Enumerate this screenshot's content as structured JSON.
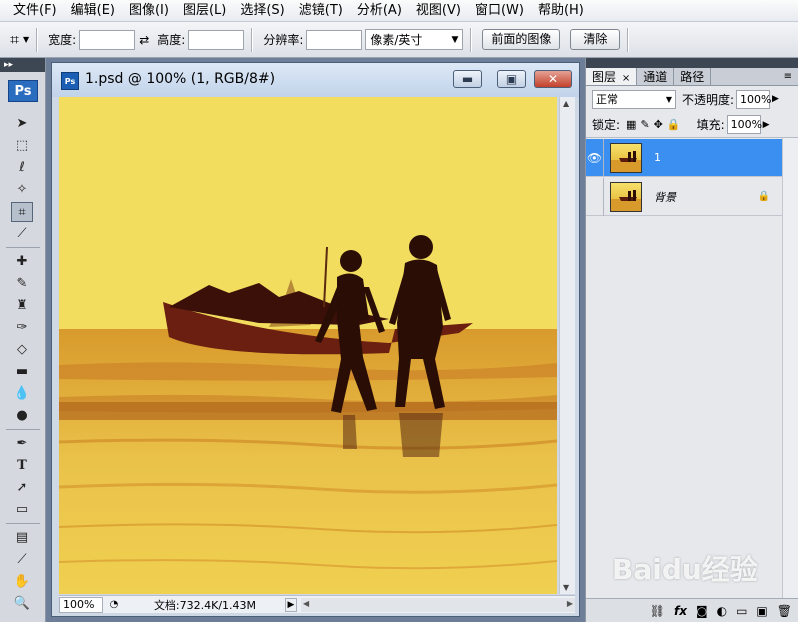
{
  "menu": [
    "文件(F)",
    "编辑(E)",
    "图像(I)",
    "图层(L)",
    "选择(S)",
    "滤镜(T)",
    "分析(A)",
    "视图(V)",
    "窗口(W)",
    "帮助(H)"
  ],
  "options": {
    "tool_icon": "crop-icon",
    "width_label": "宽度:",
    "height_label": "高度:",
    "resolution_label": "分辨率:",
    "unit_value": "像素/英寸",
    "front_image_button": "前面的图像",
    "clear_button": "清除"
  },
  "toolbox": {
    "logo": "Ps",
    "active_tool": "crop-icon"
  },
  "document": {
    "title": "1.psd @ 100% (1, RGB/8#)",
    "zoom": "100%",
    "doc_info": "文档:732.4K/1.43M"
  },
  "layers_panel": {
    "tabs": [
      "图层",
      "通道",
      "路径"
    ],
    "blend_mode": "正常",
    "opacity_label": "不透明度:",
    "opacity_value": "100%",
    "lock_label": "锁定:",
    "fill_label": "填充:",
    "fill_value": "100%",
    "layers": [
      {
        "name": "1",
        "visible": true,
        "selected": true,
        "locked": false
      },
      {
        "name": "背景",
        "visible": false,
        "selected": false,
        "locked": true
      }
    ],
    "footer_icons": [
      "link-icon",
      "fx-icon",
      "mask-icon",
      "adjustment-icon",
      "folder-icon",
      "new-layer-icon",
      "trash-icon"
    ]
  },
  "watermark": "Baidu经验",
  "colors": {
    "selected_layer": "#3b8ff0",
    "ps_blue": "#2a6dbe"
  }
}
